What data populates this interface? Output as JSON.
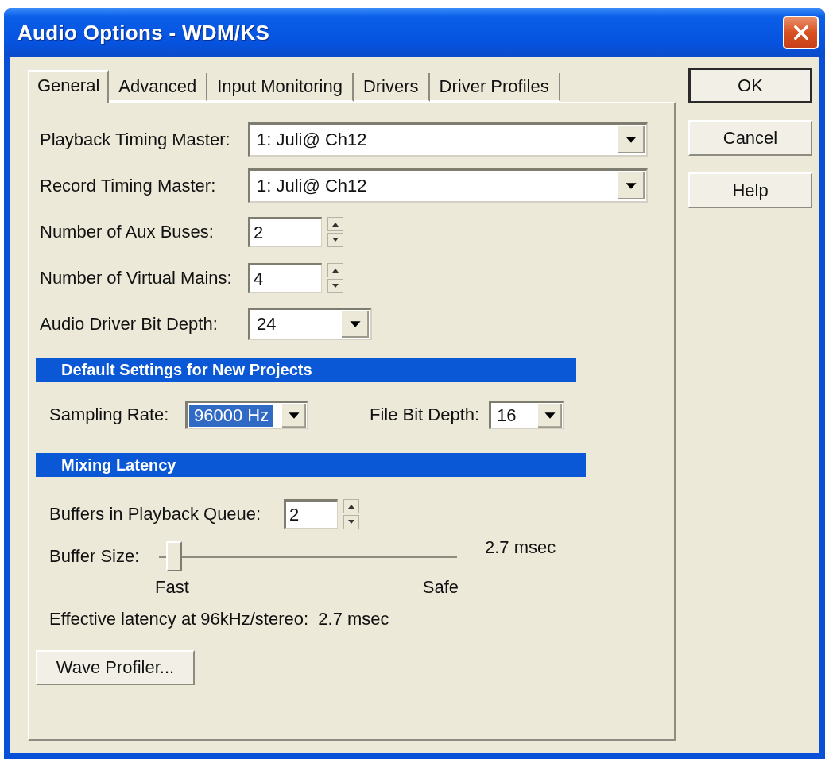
{
  "window": {
    "title": "Audio Options - WDM/KS"
  },
  "tabs": [
    {
      "label": "General",
      "selected": true
    },
    {
      "label": "Advanced",
      "selected": false
    },
    {
      "label": "Input Monitoring",
      "selected": false
    },
    {
      "label": "Drivers",
      "selected": false
    },
    {
      "label": "Driver Profiles",
      "selected": false
    }
  ],
  "general": {
    "fields": [
      {
        "kind": "dropdown",
        "label": "Playback Timing Master:",
        "value": "1: Juli@ Ch12"
      },
      {
        "kind": "dropdown",
        "label": "Record Timing Master:",
        "value": "1: Juli@ Ch12"
      },
      {
        "kind": "spin",
        "label": "Number of Aux Buses:",
        "value": "2"
      },
      {
        "kind": "spin",
        "label": "Number of Virtual Mains:",
        "value": "4"
      },
      {
        "kind": "dropdown",
        "label": "Audio Driver Bit Depth:",
        "value": "24"
      }
    ],
    "default_settings": {
      "title": "Default Settings for New Projects",
      "fields": [
        {
          "label": "Sampling Rate:",
          "value": "96000 Hz",
          "focused": true
        },
        {
          "label": "File Bit Depth:",
          "value": "16",
          "focused": false
        }
      ]
    },
    "mixing_latency": {
      "title": "Mixing Latency",
      "buffers": {
        "label": "Buffers in Playback Queue:",
        "value": "2"
      },
      "buffer_size": {
        "label": "Buffer Size:",
        "level": 0.05,
        "reading": "2.7 msec",
        "min_label": "Fast",
        "max_label": "Safe"
      },
      "effective_latency": "Effective latency at 96kHz/stereo:  2.7 msec"
    },
    "wave_profiler_button": {
      "label": "Wave Profiler..."
    }
  },
  "buttons": [
    {
      "label": "OK",
      "default": true
    },
    {
      "label": "Cancel",
      "default": false
    },
    {
      "label": "Help",
      "default": false
    }
  ]
}
